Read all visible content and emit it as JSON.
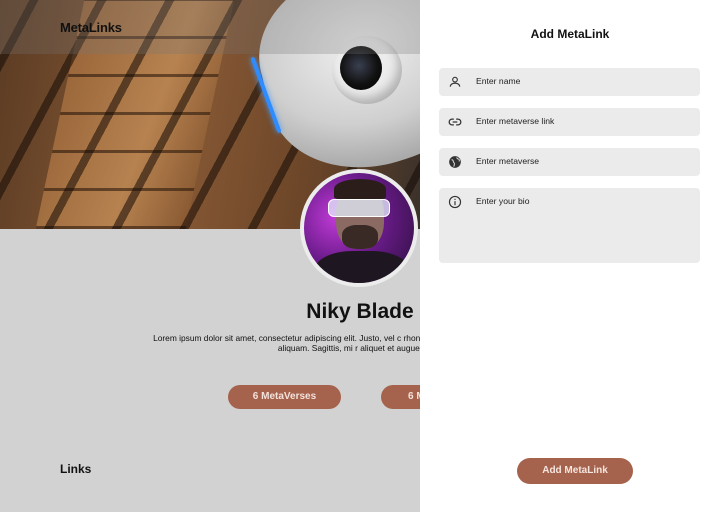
{
  "app": {
    "brand": "MetaLinks"
  },
  "profile": {
    "name": "Niky Blade",
    "bio": "Lorem ipsum dolor sit amet, consectetur adipiscing elit. Justo, vel c rhoncus sit varius. Aliquam congue facilisi id aliquam. Sagittis, mi r aliquet et augue vitae.",
    "stats": [
      {
        "label": "6 MetaVerses"
      },
      {
        "label": "6 M"
      }
    ]
  },
  "links_section": {
    "heading": "Links"
  },
  "panel": {
    "title": "Add MetaLink",
    "fields": [
      {
        "icon": "person-icon",
        "placeholder": "Enter name"
      },
      {
        "icon": "link-icon",
        "placeholder": "Enter metaverse link"
      },
      {
        "icon": "globe-icon",
        "placeholder": "Enter metaverse"
      },
      {
        "icon": "info-icon",
        "placeholder": "Enter your bio"
      }
    ],
    "submit_label": "Add MetaLink"
  },
  "colors": {
    "accent": "#a5624c",
    "page_background": "#d2d2d2",
    "panel_background": "#ffffff",
    "field_background": "#ebebeb"
  }
}
